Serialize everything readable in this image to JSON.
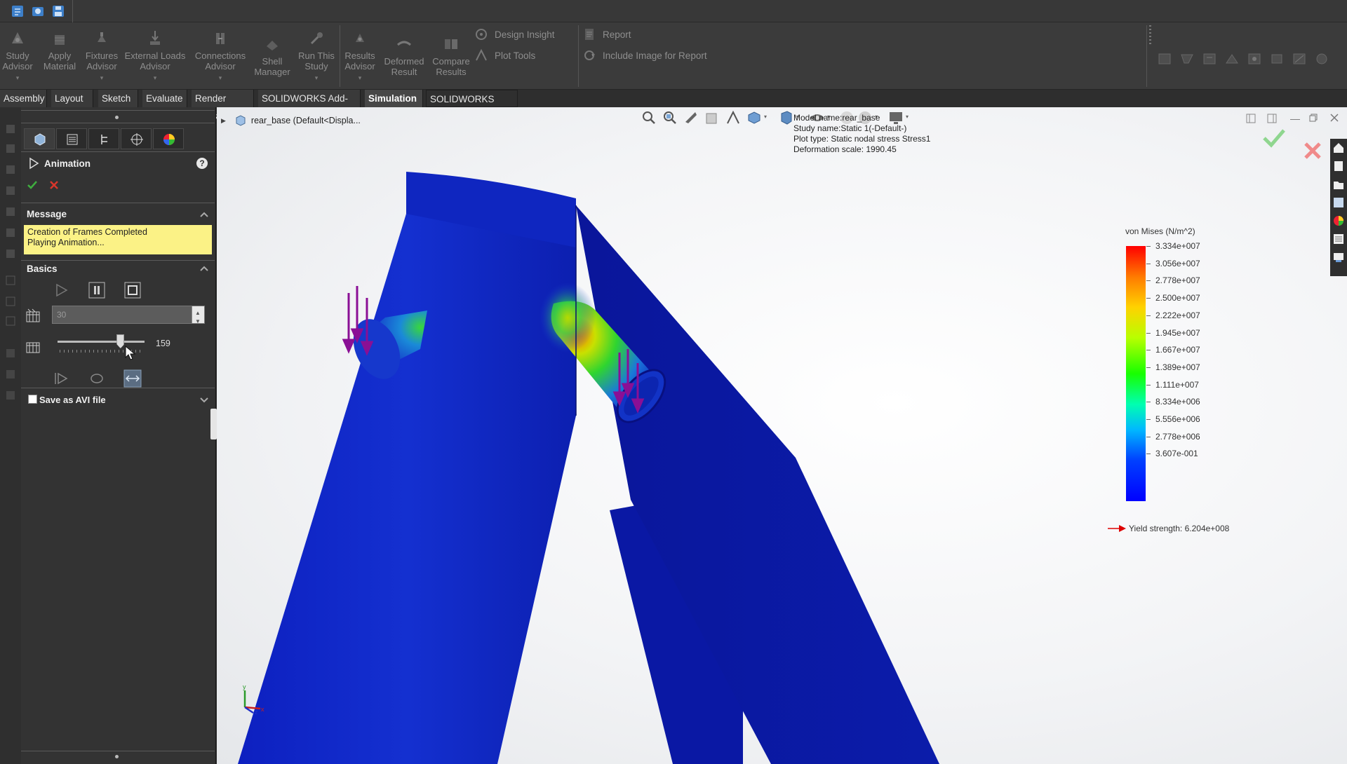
{
  "ribbon": {
    "study_advisor": [
      "Study",
      "Advisor"
    ],
    "apply_material": [
      "Apply",
      "Material"
    ],
    "fixtures_advisor": [
      "Fixtures",
      "Advisor"
    ],
    "external_loads_advisor": [
      "External Loads",
      "Advisor"
    ],
    "connections_advisor": [
      "Connections",
      "Advisor"
    ],
    "shell_manager": [
      "Shell",
      "Manager"
    ],
    "run_this_study": [
      "Run This",
      "Study"
    ],
    "results_advisor": [
      "Results",
      "Advisor"
    ],
    "deformed_result": [
      "Deformed",
      "Result"
    ],
    "compare_results": [
      "Compare",
      "Results"
    ],
    "design_insight": "Design Insight",
    "plot_tools": "Plot Tools",
    "report": "Report",
    "include_image": "Include Image for Report"
  },
  "tabs": [
    "Assembly",
    "Layout",
    "Sketch",
    "Evaluate",
    "Render Tools",
    "SOLIDWORKS Add-Ins",
    "Simulation",
    "SOLIDWORKS MBD"
  ],
  "panel": {
    "title": "Animation",
    "message_header": "Message",
    "message_lines": [
      "Creation of Frames Completed",
      "Playing Animation..."
    ],
    "basics_header": "Basics",
    "frames_value": "30",
    "slider_value": "159",
    "slider_fraction": 0.72,
    "save_avi_label": "Save as AVI file",
    "save_avi_checked": false
  },
  "viewport": {
    "tree_root": "rear_base  (Default<Displa...",
    "info": {
      "model": "Model name:rear_base",
      "study": "Study name:Static 1(-Default-)",
      "plot": "Plot type: Static nodal stress Stress1",
      "deform": "Deformation scale: 1990.45"
    },
    "legend": {
      "title": "von Mises (N/m^2)",
      "labels": [
        "3.334e+007",
        "3.056e+007",
        "2.778e+007",
        "2.500e+007",
        "2.222e+007",
        "1.945e+007",
        "1.667e+007",
        "1.389e+007",
        "1.111e+007",
        "8.334e+006",
        "5.556e+006",
        "2.778e+006",
        "3.607e-001"
      ],
      "yield": "Yield strength: 6.204e+008"
    },
    "triad": {
      "x": "x",
      "y": "y",
      "z": "z"
    }
  },
  "colors": {
    "accent_check": "#3fae3f",
    "accent_cancel": "#d9362b",
    "load_arrow": "#8a0f95",
    "message_bg": "#fbf286"
  }
}
